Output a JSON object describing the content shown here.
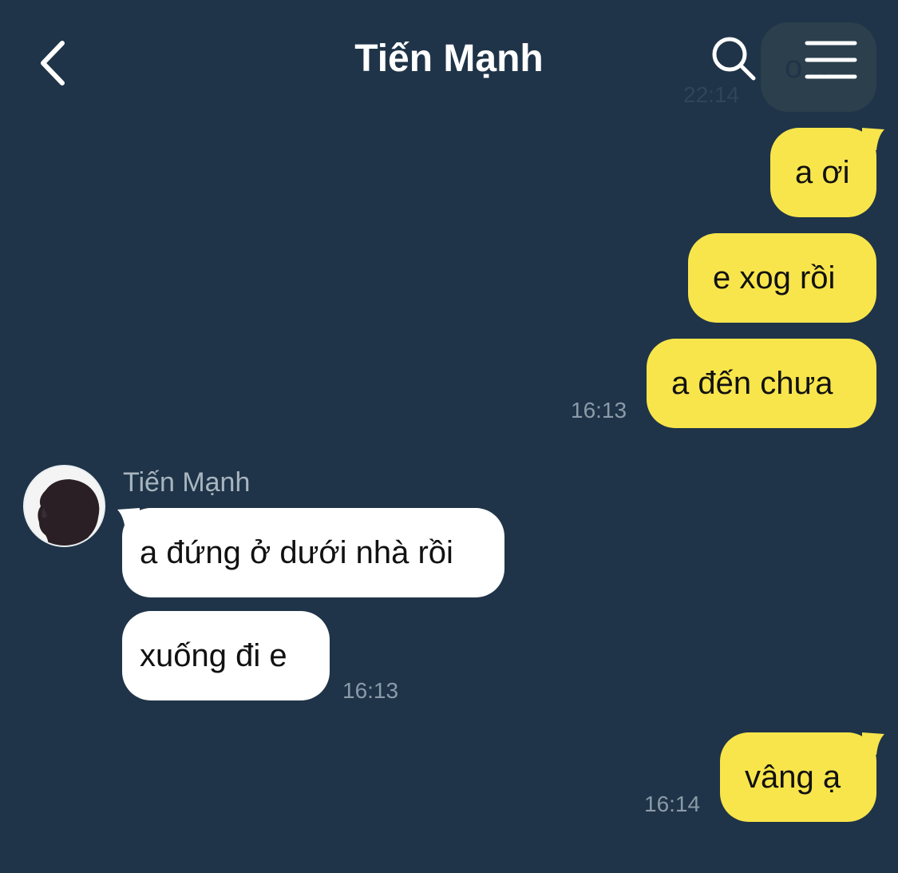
{
  "header": {
    "title": "Tiến Mạnh",
    "back_icon": "chevron-left-icon",
    "search_icon": "search-icon",
    "menu_icon": "hamburger-menu-icon"
  },
  "previous": {
    "text": "o...",
    "time": "22:14"
  },
  "messages": [
    {
      "id": "m1",
      "direction": "out",
      "text": "a ơi",
      "time": ""
    },
    {
      "id": "m2",
      "direction": "out",
      "text": "e xog rồi",
      "time": ""
    },
    {
      "id": "m3",
      "direction": "out",
      "text": "a đến chưa",
      "time": "16:13"
    },
    {
      "id": "m4",
      "direction": "in",
      "sender": "Tiến Mạnh",
      "text": "a đứng ở dưới nhà rồi",
      "time": ""
    },
    {
      "id": "m5",
      "direction": "in",
      "text": "xuống đi e",
      "time": "16:13"
    },
    {
      "id": "m6",
      "direction": "out",
      "text": "vâng ạ",
      "time": "16:14"
    }
  ],
  "colors": {
    "background": "#1f3448",
    "outgoing_bubble": "#f8e54b",
    "incoming_bubble": "#ffffff",
    "timestamp": "#8b9aa8",
    "sender_name": "#a8b5c0"
  }
}
